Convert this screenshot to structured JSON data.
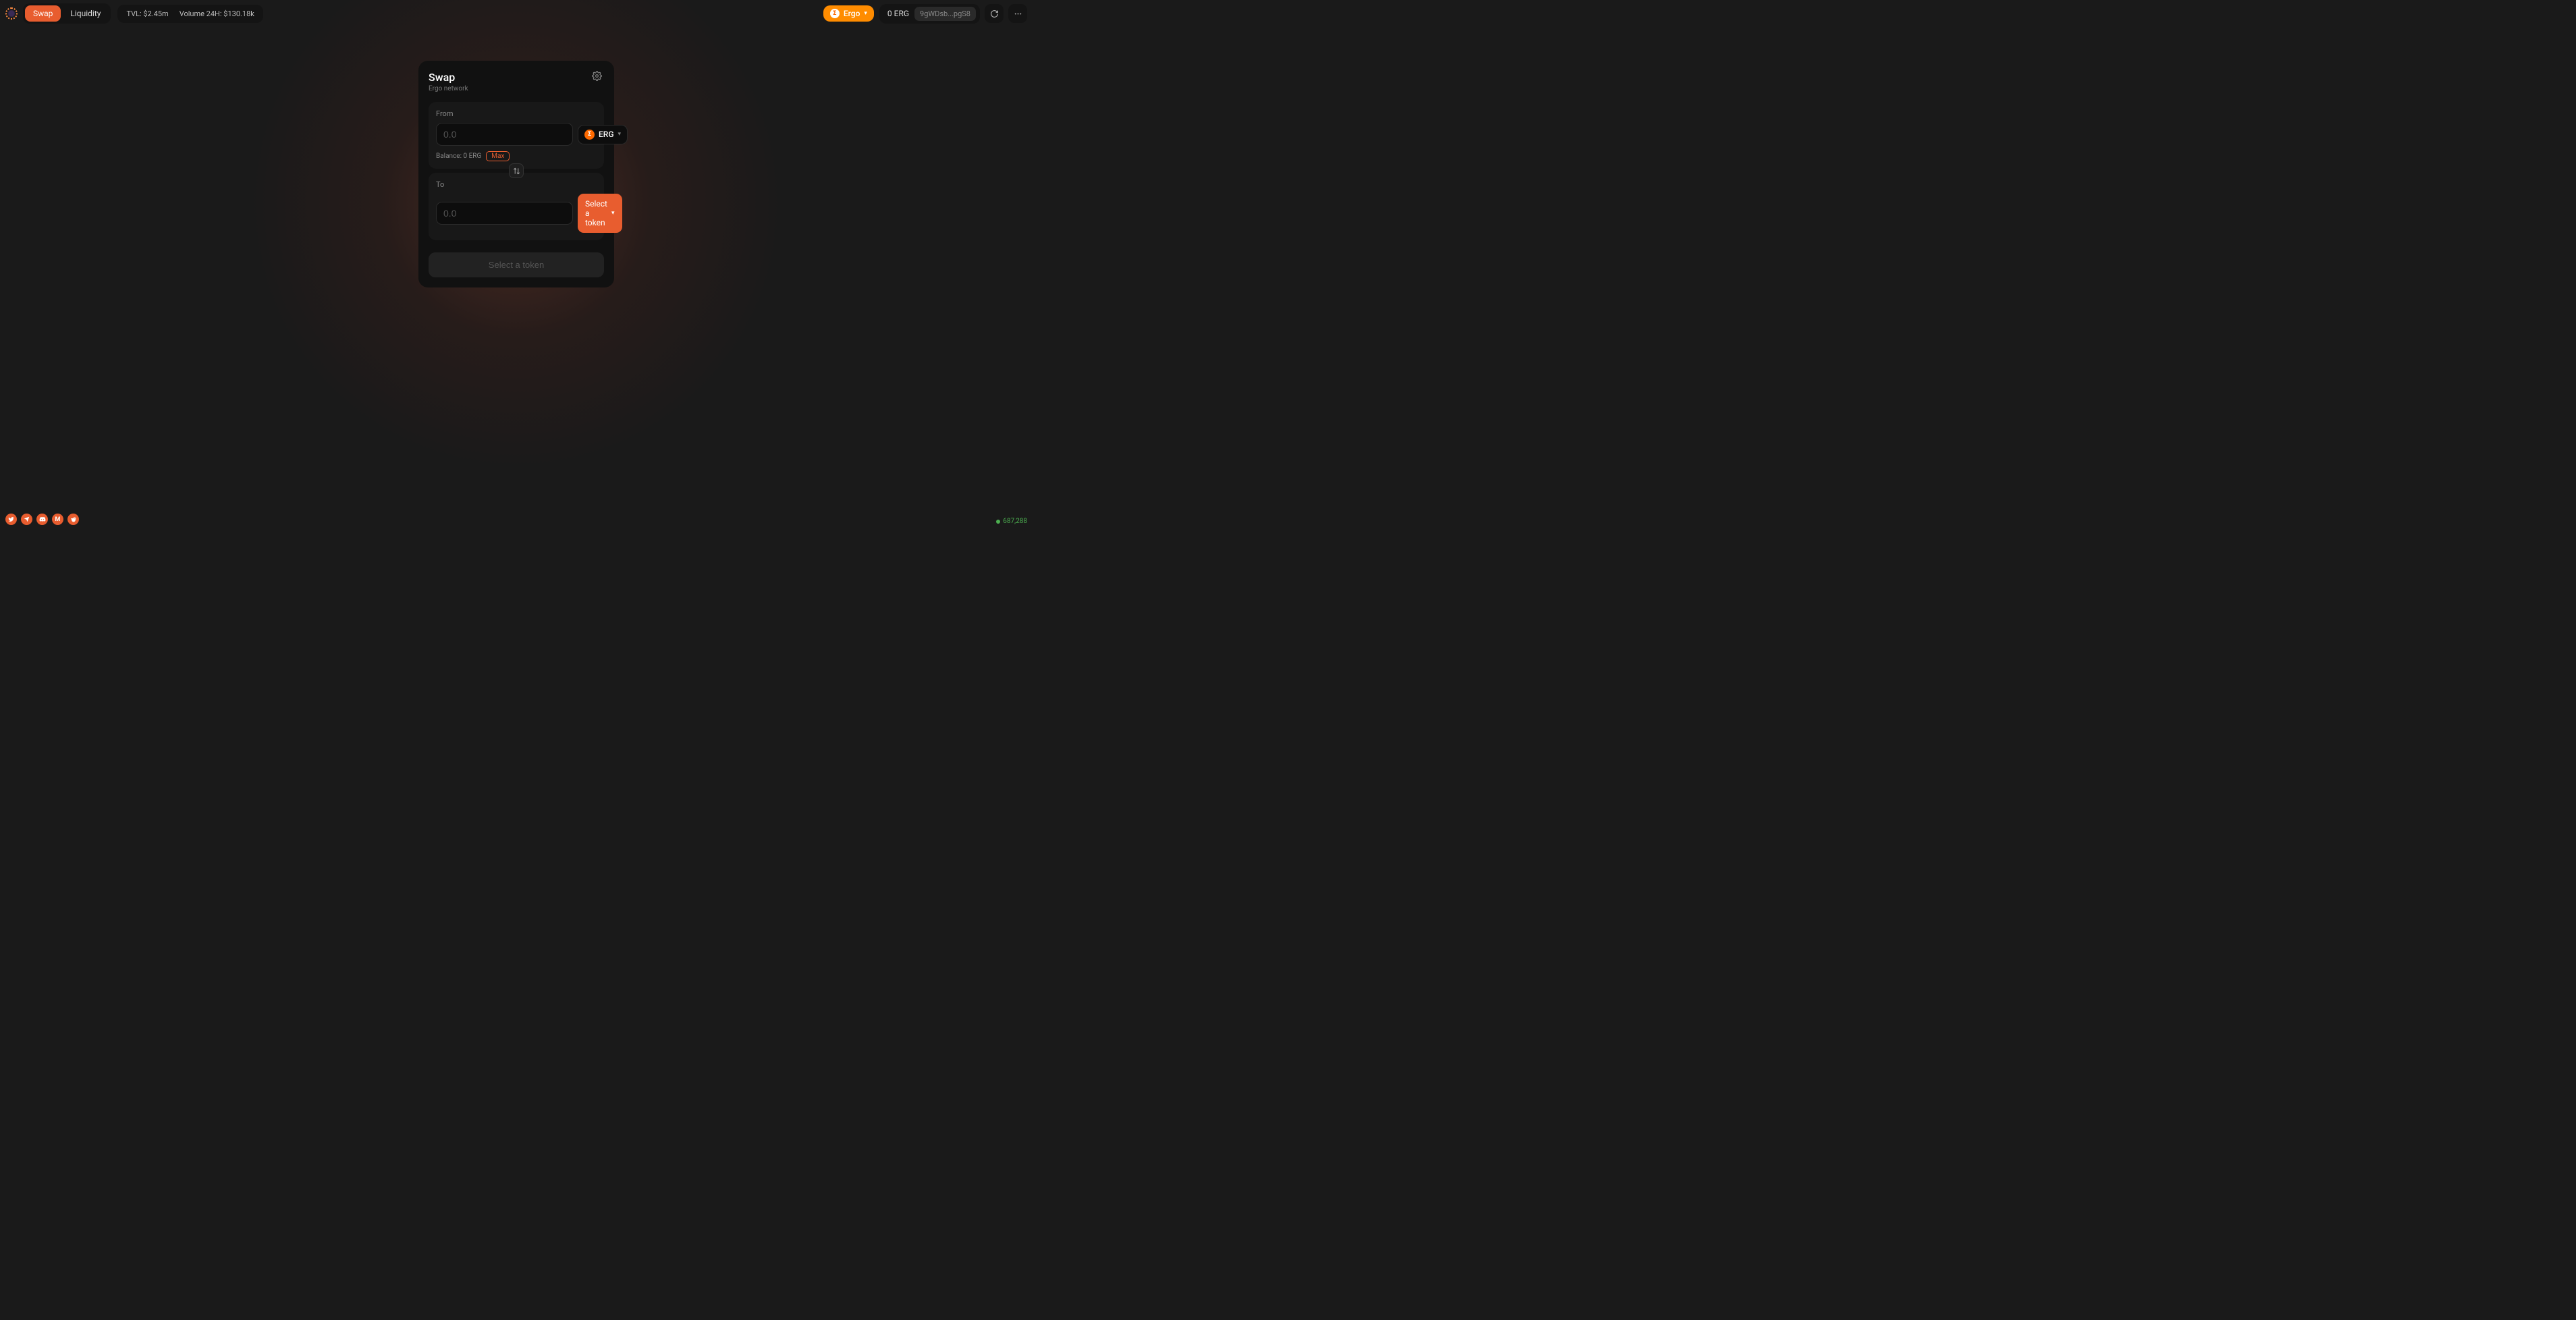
{
  "nav": {
    "swap": "Swap",
    "liquidity": "Liquidity"
  },
  "stats": {
    "tvl": "TVL: $2.45m",
    "volume": "Volume 24H: $130.18k"
  },
  "network": {
    "name": "Ergo"
  },
  "wallet": {
    "balance": "0 ERG",
    "address": "9gWDsb...pgS8"
  },
  "card": {
    "title": "Swap",
    "subtitle": "Ergo network",
    "from": {
      "label": "From",
      "placeholder": "0.0",
      "token": "ERG",
      "balance": "Balance: 0 ERG",
      "max": "Max"
    },
    "to": {
      "label": "To",
      "placeholder": "0.0",
      "select": "Select a token"
    },
    "mainButton": "Select a token"
  },
  "block": "687,288",
  "social": {
    "medium": "M"
  }
}
